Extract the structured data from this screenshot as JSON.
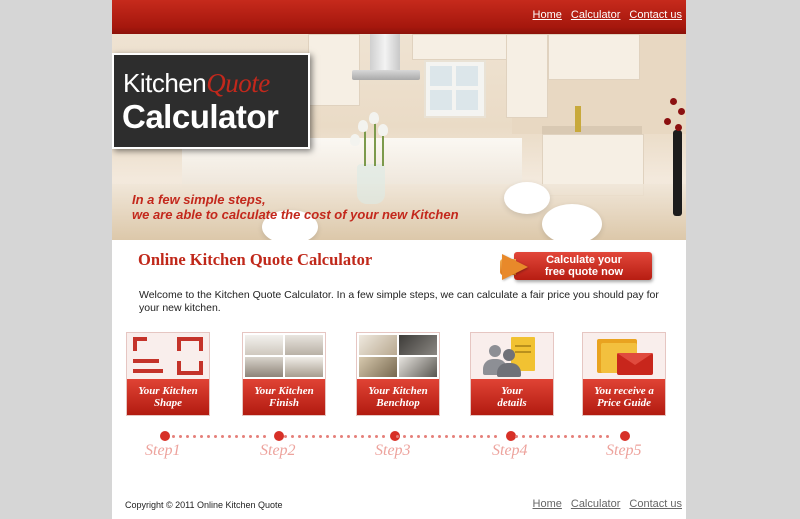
{
  "top_nav": {
    "home": "Home",
    "calculator": "Calculator",
    "contact": "Contact us"
  },
  "logo": {
    "word1": "Kitchen",
    "word2": "Quote",
    "word3": "Calculator"
  },
  "hero": {
    "line1": "In a few simple steps,",
    "line2": "we are able to calculate the cost of your new Kitchen"
  },
  "main": {
    "heading": "Online Kitchen Quote Calculator",
    "cta_line1": "Calculate your",
    "cta_line2": "free quote now",
    "intro": "Welcome to the Kitchen Quote Calculator. In a few simple steps, we can calculate a fair price you should pay for your new kitchen."
  },
  "steps": [
    {
      "line1": "Your Kitchen",
      "line2": "Shape",
      "label": "Step1"
    },
    {
      "line1": "Your Kitchen",
      "line2": "Finish",
      "label": "Step2"
    },
    {
      "line1": "Your Kitchen",
      "line2": "Benchtop",
      "label": "Step3"
    },
    {
      "line1": "Your",
      "line2": "details",
      "label": "Step4"
    },
    {
      "line1": "You receive a",
      "line2": "Price Guide",
      "label": "Step5"
    }
  ],
  "footer": {
    "copyright": "Copyright © 2011 Online Kitchen Quote",
    "home": "Home",
    "calculator": "Calculator",
    "contact": "Contact us"
  },
  "colors": {
    "accent_red": "#c3281c",
    "cta_orange": "#e8892a",
    "page_background": "#d6d6d6"
  }
}
